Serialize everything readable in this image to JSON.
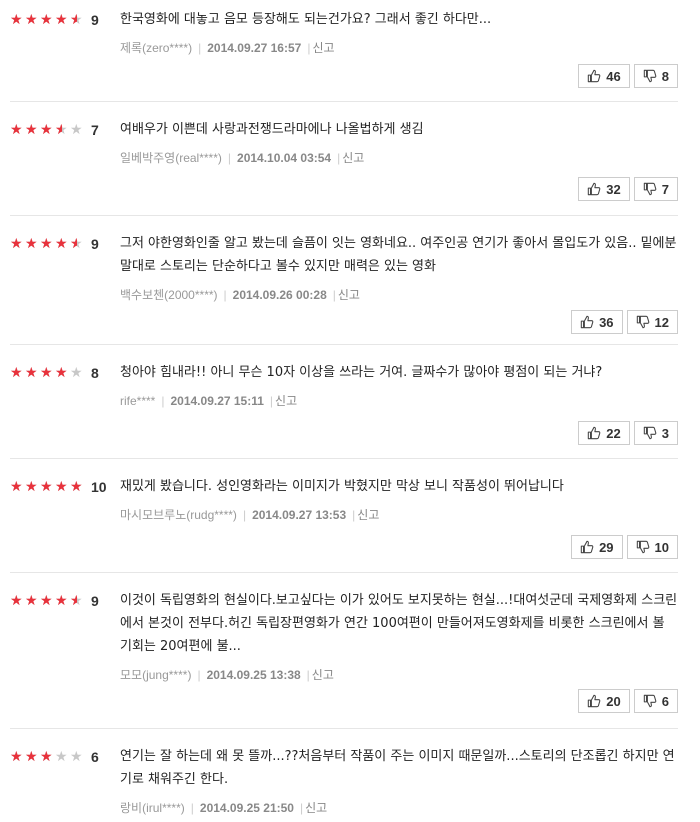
{
  "colors": {
    "star_active": "#e8323c",
    "star_inactive": "#c8c8c8",
    "divider": "#e6e6e6"
  },
  "icons": {
    "like": "thumbs-up-icon",
    "dislike": "thumbs-down-icon",
    "star": "star-icon"
  },
  "report_label": "신고",
  "reviews": [
    {
      "rating": 9,
      "score": "9",
      "text": "한국영화에 대놓고 음모 등장해도 되는건가요? 그래서 좋긴 하다만...",
      "user": "제록(zero****)",
      "date": "2014.09.27 16:57",
      "likes": "46",
      "dislikes": "8"
    },
    {
      "rating": 7,
      "score": "7",
      "text": "여배우가 이쁜데 사랑과전쟁드라마에나 나올법하게 생김",
      "user": "일베박주영(real****)",
      "date": "2014.10.04 03:54",
      "likes": "32",
      "dislikes": "7"
    },
    {
      "rating": 9,
      "score": "9",
      "text": "그저 야한영화인줄 알고 봤는데 슬픔이 잇는 영화네요.. 여주인공 연기가 좋아서 몰입도가 있음.. 밑에분 말대로 스토리는 단순하다고 볼수 있지만 매력은 있는 영화",
      "user": "백수보첸(2000****)",
      "date": "2014.09.26 00:28",
      "likes": "36",
      "dislikes": "12"
    },
    {
      "rating": 8,
      "score": "8",
      "text": "청아야 힘내라!! 아니 무슨 10자 이상을 쓰라는 거여. 글짜수가 많아야 평점이 되는 거냐?",
      "user": "rife****",
      "date": "2014.09.27 15:11",
      "likes": "22",
      "dislikes": "3"
    },
    {
      "rating": 10,
      "score": "10",
      "text": "재밌게 봤습니다. 성인영화라는 이미지가 박혔지만 막상 보니 작품성이 뛰어납니다",
      "user": "마시모브루노(rudg****)",
      "date": "2014.09.27 13:53",
      "likes": "29",
      "dislikes": "10"
    },
    {
      "rating": 9,
      "score": "9",
      "text": "이것이 독립영화의 현실이다.보고싶다는 이가 있어도 보지못하는 현실...!대여섯군데 국제영화제 스크린에서 본것이 전부다.허긴 독립장편영화가 연간 100여편이 만들어져도영화제를 비롯한 스크린에서 볼 기회는 20여편에 불...",
      "user": "모모(jung****)",
      "date": "2014.09.25 13:38",
      "likes": "20",
      "dislikes": "6"
    },
    {
      "rating": 6,
      "score": "6",
      "text": "연기는 잘 하는데 왜 못 뜰까...??처음부터 작품이 주는 이미지 때문일까...스토리의 단조롭긴 하지만 연기로 채워주긴 한다.",
      "user": "랑비(irul****)",
      "date": "2014.09.25 21:50",
      "likes": null,
      "dislikes": null
    }
  ]
}
